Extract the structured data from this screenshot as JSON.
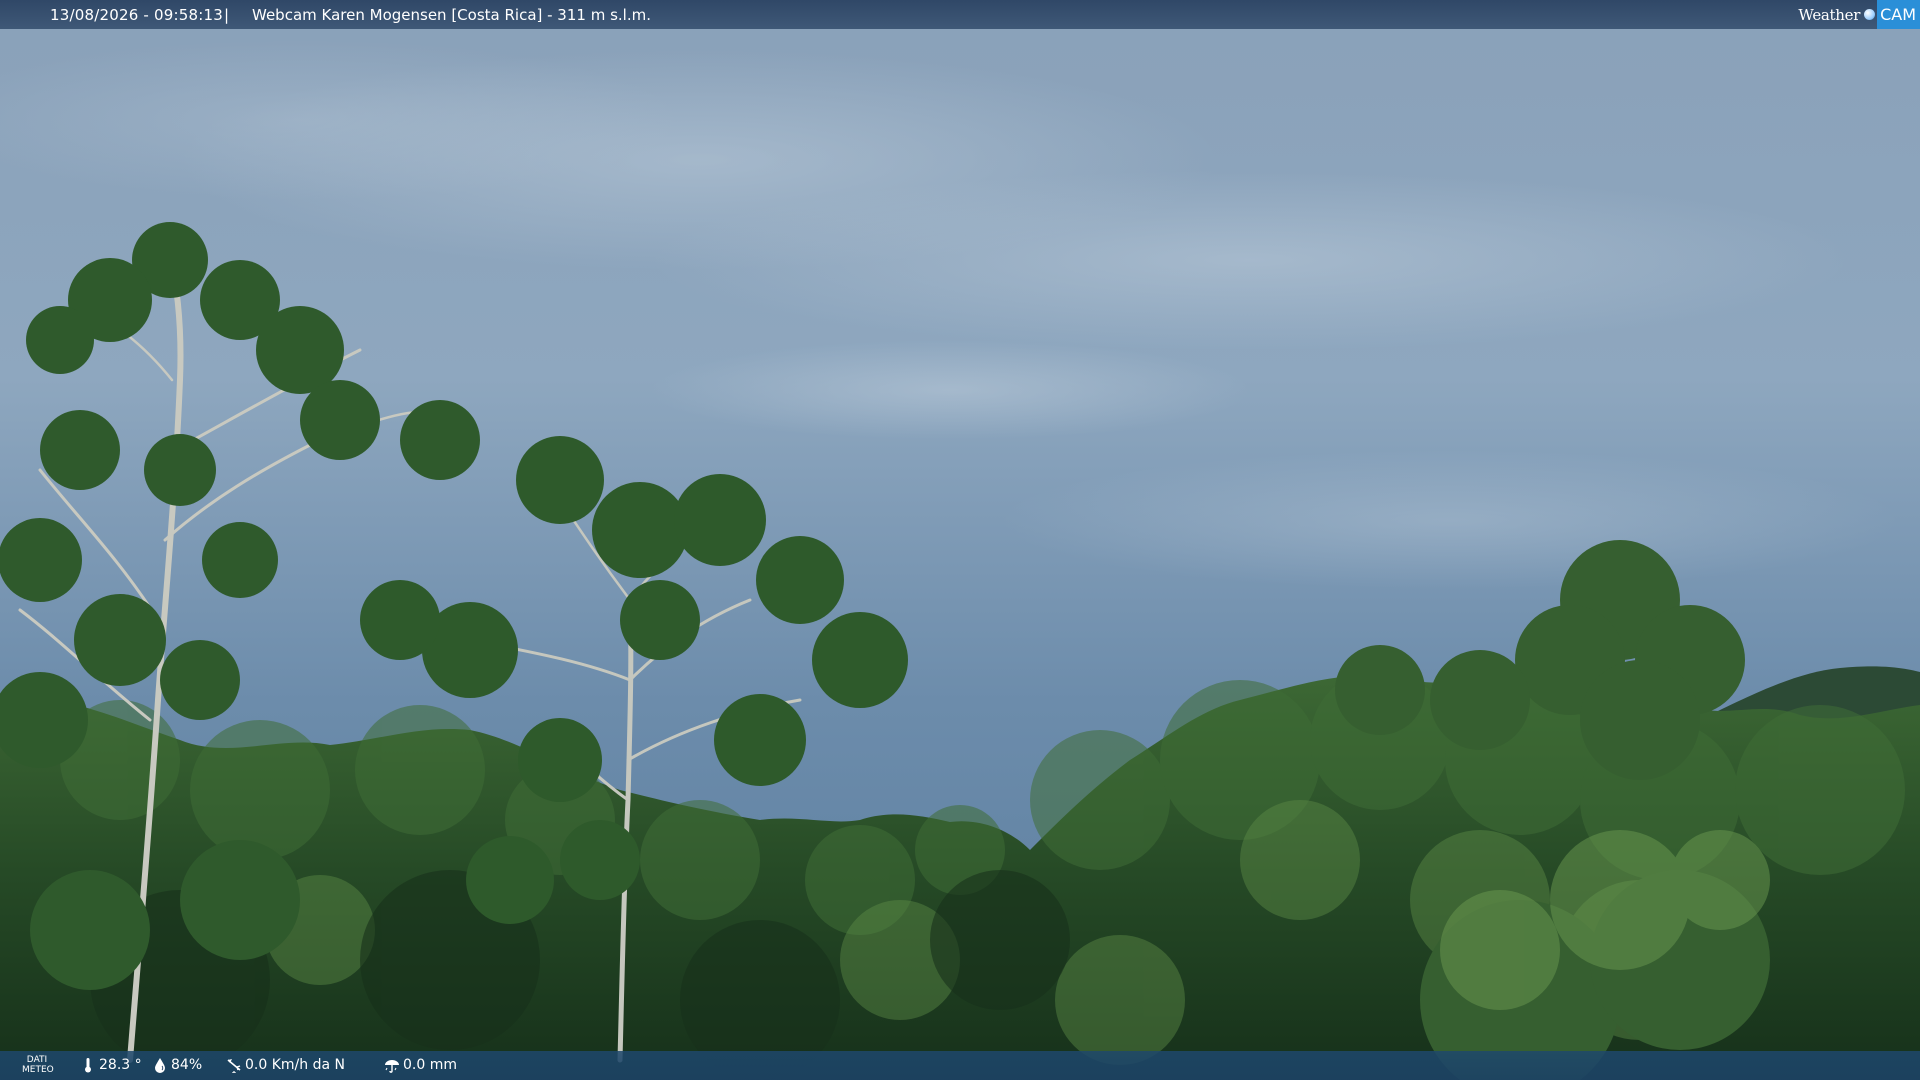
{
  "header": {
    "datetime": "13/08/2026 - 09:58:13",
    "separator": "|",
    "title": "Webcam Karen Mogensen [Costa Rica]  - 311 m s.l.m."
  },
  "logo": {
    "weather": "Weather",
    "cam": "CAM"
  },
  "weather_data": {
    "label_line1": "DATI",
    "label_line2": "METEO",
    "temperature": "28.3 °",
    "humidity": "84%",
    "wind": "0.0 Km/h da N",
    "rain": "0.0 mm"
  },
  "icons": {
    "temperature": "thermometer-icon",
    "humidity": "humidity-drop-icon",
    "wind": "wind-vane-icon",
    "rain": "rain-gauge-icon"
  },
  "colors": {
    "sky_top": "#8fa7bf",
    "sky_bottom": "#5f7e9e",
    "foliage_dark": "#1e3a1c",
    "foliage_light": "#4f7a3a",
    "bar": "#2e4a6c",
    "logo_accent": "#2a8fd8"
  }
}
